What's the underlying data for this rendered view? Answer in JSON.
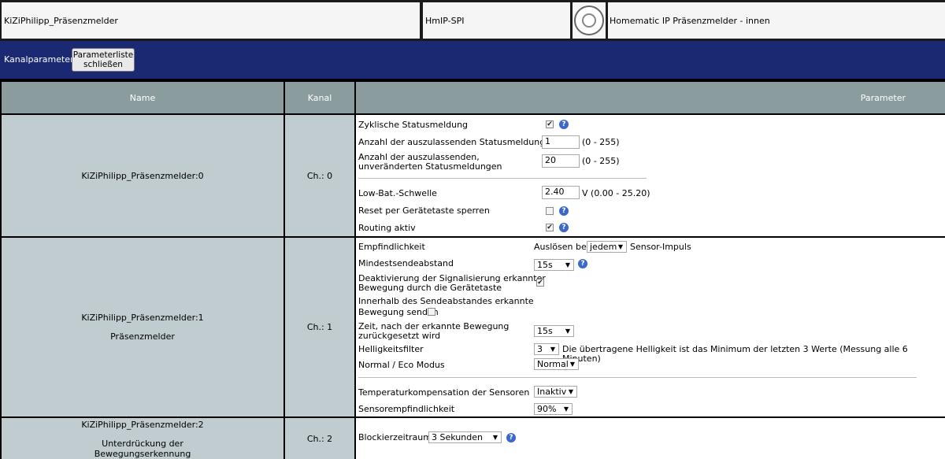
{
  "device": {
    "name": "KiZiPhilipp_Präsenzmelder",
    "type": "HmIP-SPI",
    "description": "Homematic IP Präsenzmelder - innen",
    "icon": "device-round-sensor-icon"
  },
  "toolbar": {
    "label": "Kanalparameter",
    "close_line1": "Parameterliste",
    "close_line2": "schließen"
  },
  "columns": {
    "name": "Name",
    "channel": "Kanal",
    "parameter": "Parameter"
  },
  "channels": [
    {
      "name": "KiZiPhilipp_Präsenzmelder:0",
      "subtitle": "",
      "ch": "Ch.: 0",
      "params": {
        "cyclic_label": "Zyklische Statusmeldung",
        "cyclic_checked": true,
        "skip_label": "Anzahl der auszulassenden Statusmeldungen",
        "skip_value": "1",
        "skip_range": "(0 - 255)",
        "skip_unchanged_line1": "Anzahl der auszulassenden,",
        "skip_unchanged_line2": "unveränderten Statusmeldungen",
        "skip_unchanged_value": "20",
        "skip_unchanged_range": "(0 - 255)",
        "lowbat_label": "Low-Bat.-Schwelle",
        "lowbat_value": "2.40",
        "lowbat_range": "V (0.00 - 25.20)",
        "reset_lock_label": "Reset per Gerätetaste sperren",
        "reset_lock_checked": false,
        "routing_label": "Routing aktiv",
        "routing_checked": true
      }
    },
    {
      "name": "KiZiPhilipp_Präsenzmelder:1",
      "subtitle": "Präsenzmelder",
      "ch": "Ch.: 1",
      "params": {
        "sensitivity_label": "Empfindlichkeit",
        "sensitivity_prefix": "Auslösen bei",
        "sensitivity_value": "jedem",
        "sensitivity_suffix": "Sensor-Impuls",
        "min_interval_label": "Mindestsendeabstand",
        "min_interval_value": "15s",
        "deactivate_line1": "Deaktivierung der Signalisierung erkannter",
        "deactivate_line2": "Bewegung durch die Gerätetaste",
        "deactivate_checked": true,
        "within_line1": "Innerhalb des Sendeabstandes erkannte",
        "within_line2": "Bewegung senden",
        "within_checked": false,
        "reset_time_line1": "Zeit, nach der erkannte Bewegung",
        "reset_time_line2": "zurückgesetzt wird",
        "reset_time_value": "15s",
        "brightness_label": "Helligkeitsfilter",
        "brightness_value": "3",
        "brightness_note": "Die übertragene Helligkeit ist das Minimum der letzten 3 Werte (Messung alle 6 Minuten)",
        "eco_label": "Normal / Eco Modus",
        "eco_value": "Normal",
        "tempcomp_label": "Temperaturkompensation der Sensoren",
        "tempcomp_value": "Inaktiv",
        "sensor_sens_label": "Sensorempfindlichkeit",
        "sensor_sens_value": "90%"
      }
    },
    {
      "name": "KiZiPhilipp_Präsenzmelder:2",
      "subtitle_line1": "Unterdrückung der",
      "subtitle_line2": "Bewegungserkennung",
      "ch": "Ch.: 2",
      "params": {
        "block_label": "Blockierzeitraum",
        "block_value": "3 Sekunden"
      }
    }
  ],
  "colors": {
    "bar": "#1b2973",
    "header_cell": "#8b9c9e",
    "name_cell": "#c0cccf",
    "help": "#3b68c9"
  }
}
